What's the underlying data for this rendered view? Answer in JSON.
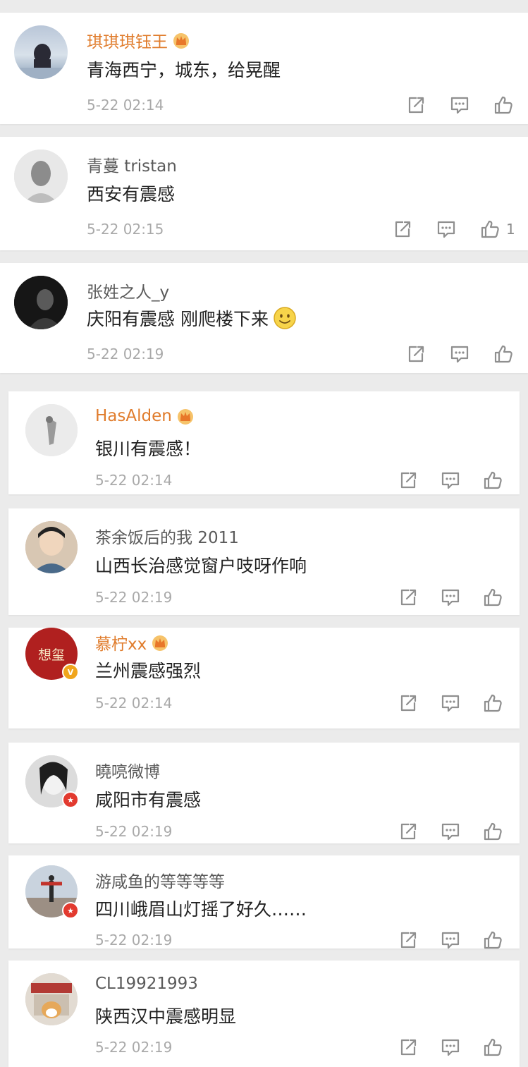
{
  "colors": {
    "vip_name": "#e07c2c",
    "name": "#5a5a5a",
    "time": "#a9a9a9",
    "background": "#ebebeb"
  },
  "icons": [
    "share-icon",
    "reply-icon",
    "like-icon",
    "crown-icon",
    "smile-emoji-icon",
    "verified-badge-icon"
  ],
  "comments": [
    {
      "user": "琪琪琪钰王",
      "text": "青海西宁，城东，给晃醒",
      "time": "5-22 02:14"
    },
    {
      "user": "青蔓 tristan",
      "text": "西安有震感",
      "time": "5-22 02:15",
      "likes": "1"
    },
    {
      "user": "张姓之人_y",
      "text": "庆阳有震感 刚爬楼下来",
      "time": "5-22 02:19"
    },
    {
      "user": "HasAlden",
      "text": "银川有震感！",
      "time": "5-22 02:14"
    },
    {
      "user": "茶余饭后的我 2011",
      "text": "山西长治感觉窗户吱呀作响",
      "time": "5-22 02:19"
    },
    {
      "user": "慕柠xx",
      "text": "兰州震感强烈",
      "time": "5-22 02:14",
      "avatar_text": "想玺"
    },
    {
      "user": "曉喨微博",
      "text": "咸阳市有震感",
      "time": "5-22 02:19"
    },
    {
      "user": "游咸鱼的等等等等",
      "text": "四川峨眉山灯摇了好久……",
      "time": "5-22 02:19"
    },
    {
      "user": "CL19921993",
      "text": "陕西汉中震感明显",
      "time": "5-22 02:19"
    }
  ]
}
